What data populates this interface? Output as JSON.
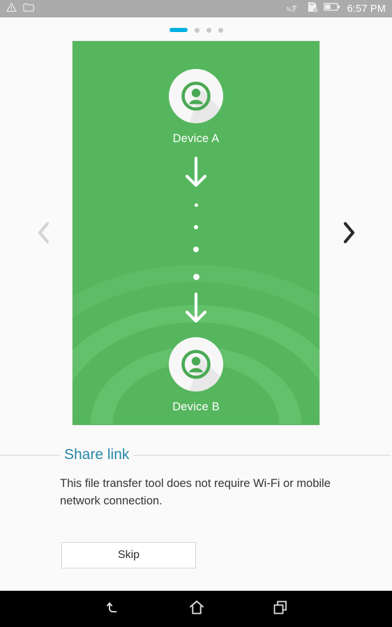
{
  "statusbar": {
    "time": "6:57 PM",
    "left_icons": [
      {
        "name": "warning-triangle-icon"
      },
      {
        "name": "photo-image-icon"
      }
    ],
    "right_icons": [
      {
        "name": "nfc-icon",
        "label": "NFC"
      },
      {
        "name": "sd-card-removed-icon"
      },
      {
        "name": "battery-icon"
      }
    ]
  },
  "pager": {
    "count": 4,
    "active_index": 0,
    "active_color": "#00b0e0",
    "inactive_color": "#c8c8c8"
  },
  "carousel": {
    "prev_label": "‹",
    "next_label": "›",
    "prev_enabled": false,
    "next_enabled": true,
    "card": {
      "background_color": "#55b65d",
      "wave_color": "#62bf69",
      "device_a_label": "Device A",
      "device_b_label": "Device B",
      "flow_dots": 4
    }
  },
  "section": {
    "title": "Share link",
    "title_color": "#2586a8"
  },
  "content": {
    "description": "This file transfer tool does not require Wi-Fi or mobile network connection."
  },
  "actions": {
    "skip_label": "Skip"
  },
  "navbar": {
    "back_label": "back",
    "home_label": "home",
    "recents_label": "recent apps"
  }
}
